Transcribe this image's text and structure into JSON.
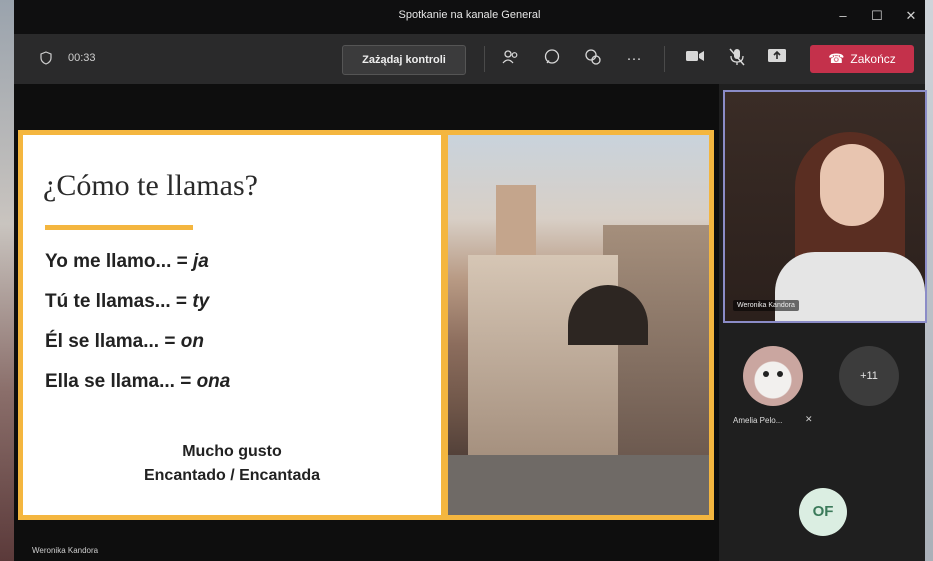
{
  "window": {
    "title": "Spotkanie na kanale General",
    "controls": {
      "minimize": "–",
      "maximize": "☐",
      "close": "✕"
    }
  },
  "toolbar": {
    "timer": "00:33",
    "request_control": "Zażądaj kontroli",
    "icons": [
      "people-icon",
      "chat-icon",
      "reactions-icon",
      "more-icon",
      "camera-icon",
      "mic-off-icon",
      "share-icon"
    ],
    "more": "···",
    "leave_label": "Zakończ",
    "leave_color": "#c4314b"
  },
  "slide": {
    "title": "¿Cómo te llamas?",
    "lines": [
      {
        "text": "Yo me llamo... = ",
        "em": "ja"
      },
      {
        "text": "Tú te llamas... = ",
        "em": "ty"
      },
      {
        "text": "Él se llama... = ",
        "em": "on"
      },
      {
        "text": "Ella se llama... = ",
        "em": "ona"
      }
    ],
    "footer_1": "Mucho gusto",
    "footer_2": "Encantado / Encantada",
    "accent_color": "#f4b63f"
  },
  "presenter": {
    "name": "Weronika Kandora"
  },
  "participants": {
    "main_video_name": "Weronika Kandora",
    "amelia_label": "Amelia Pelo...",
    "more_count": "+11",
    "of_initials": "OF"
  }
}
